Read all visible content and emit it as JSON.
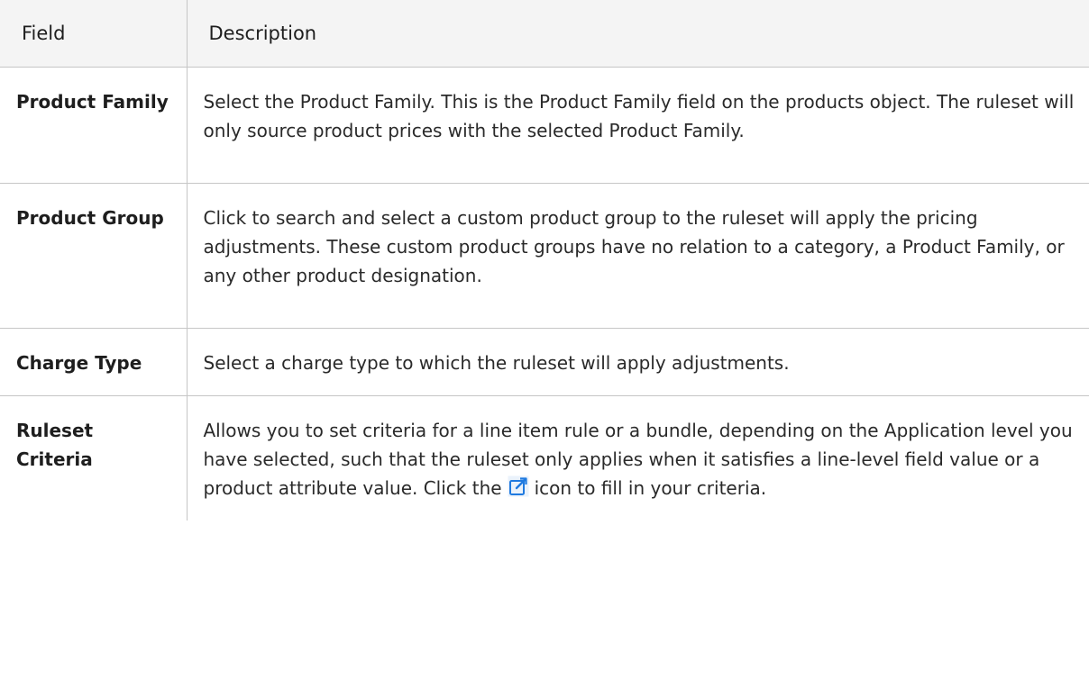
{
  "table": {
    "headers": {
      "field": "Field",
      "description": "Description"
    },
    "rows": [
      {
        "field": "Product Family",
        "description": "Select the Product Family. This is the Product Family field on the products object. The ruleset will only source product prices with the selected Product Family."
      },
      {
        "field": "Product Group",
        "description": "Click to search and select a custom product group to the ruleset will apply the pricing adjustments. These custom product groups have no relation to a category, a Product Family, or any other product designation."
      },
      {
        "field": "Charge Type",
        "description": "Select a charge type to which the ruleset will apply adjustments."
      },
      {
        "field": "Ruleset Criteria",
        "description_before_icon": "Allows you to set criteria for a line item rule or a bundle, depending on the Application level you have selected, such that the ruleset only applies when it satisfies a line-level field value or a product attribute value. Click the",
        "icon": "edit-external-icon",
        "description_after_icon": "icon to fill in your criteria."
      }
    ]
  },
  "colors": {
    "header_background": "#f4f4f4",
    "border": "#c6c6c6",
    "icon_blue": "#1f7ae0"
  }
}
